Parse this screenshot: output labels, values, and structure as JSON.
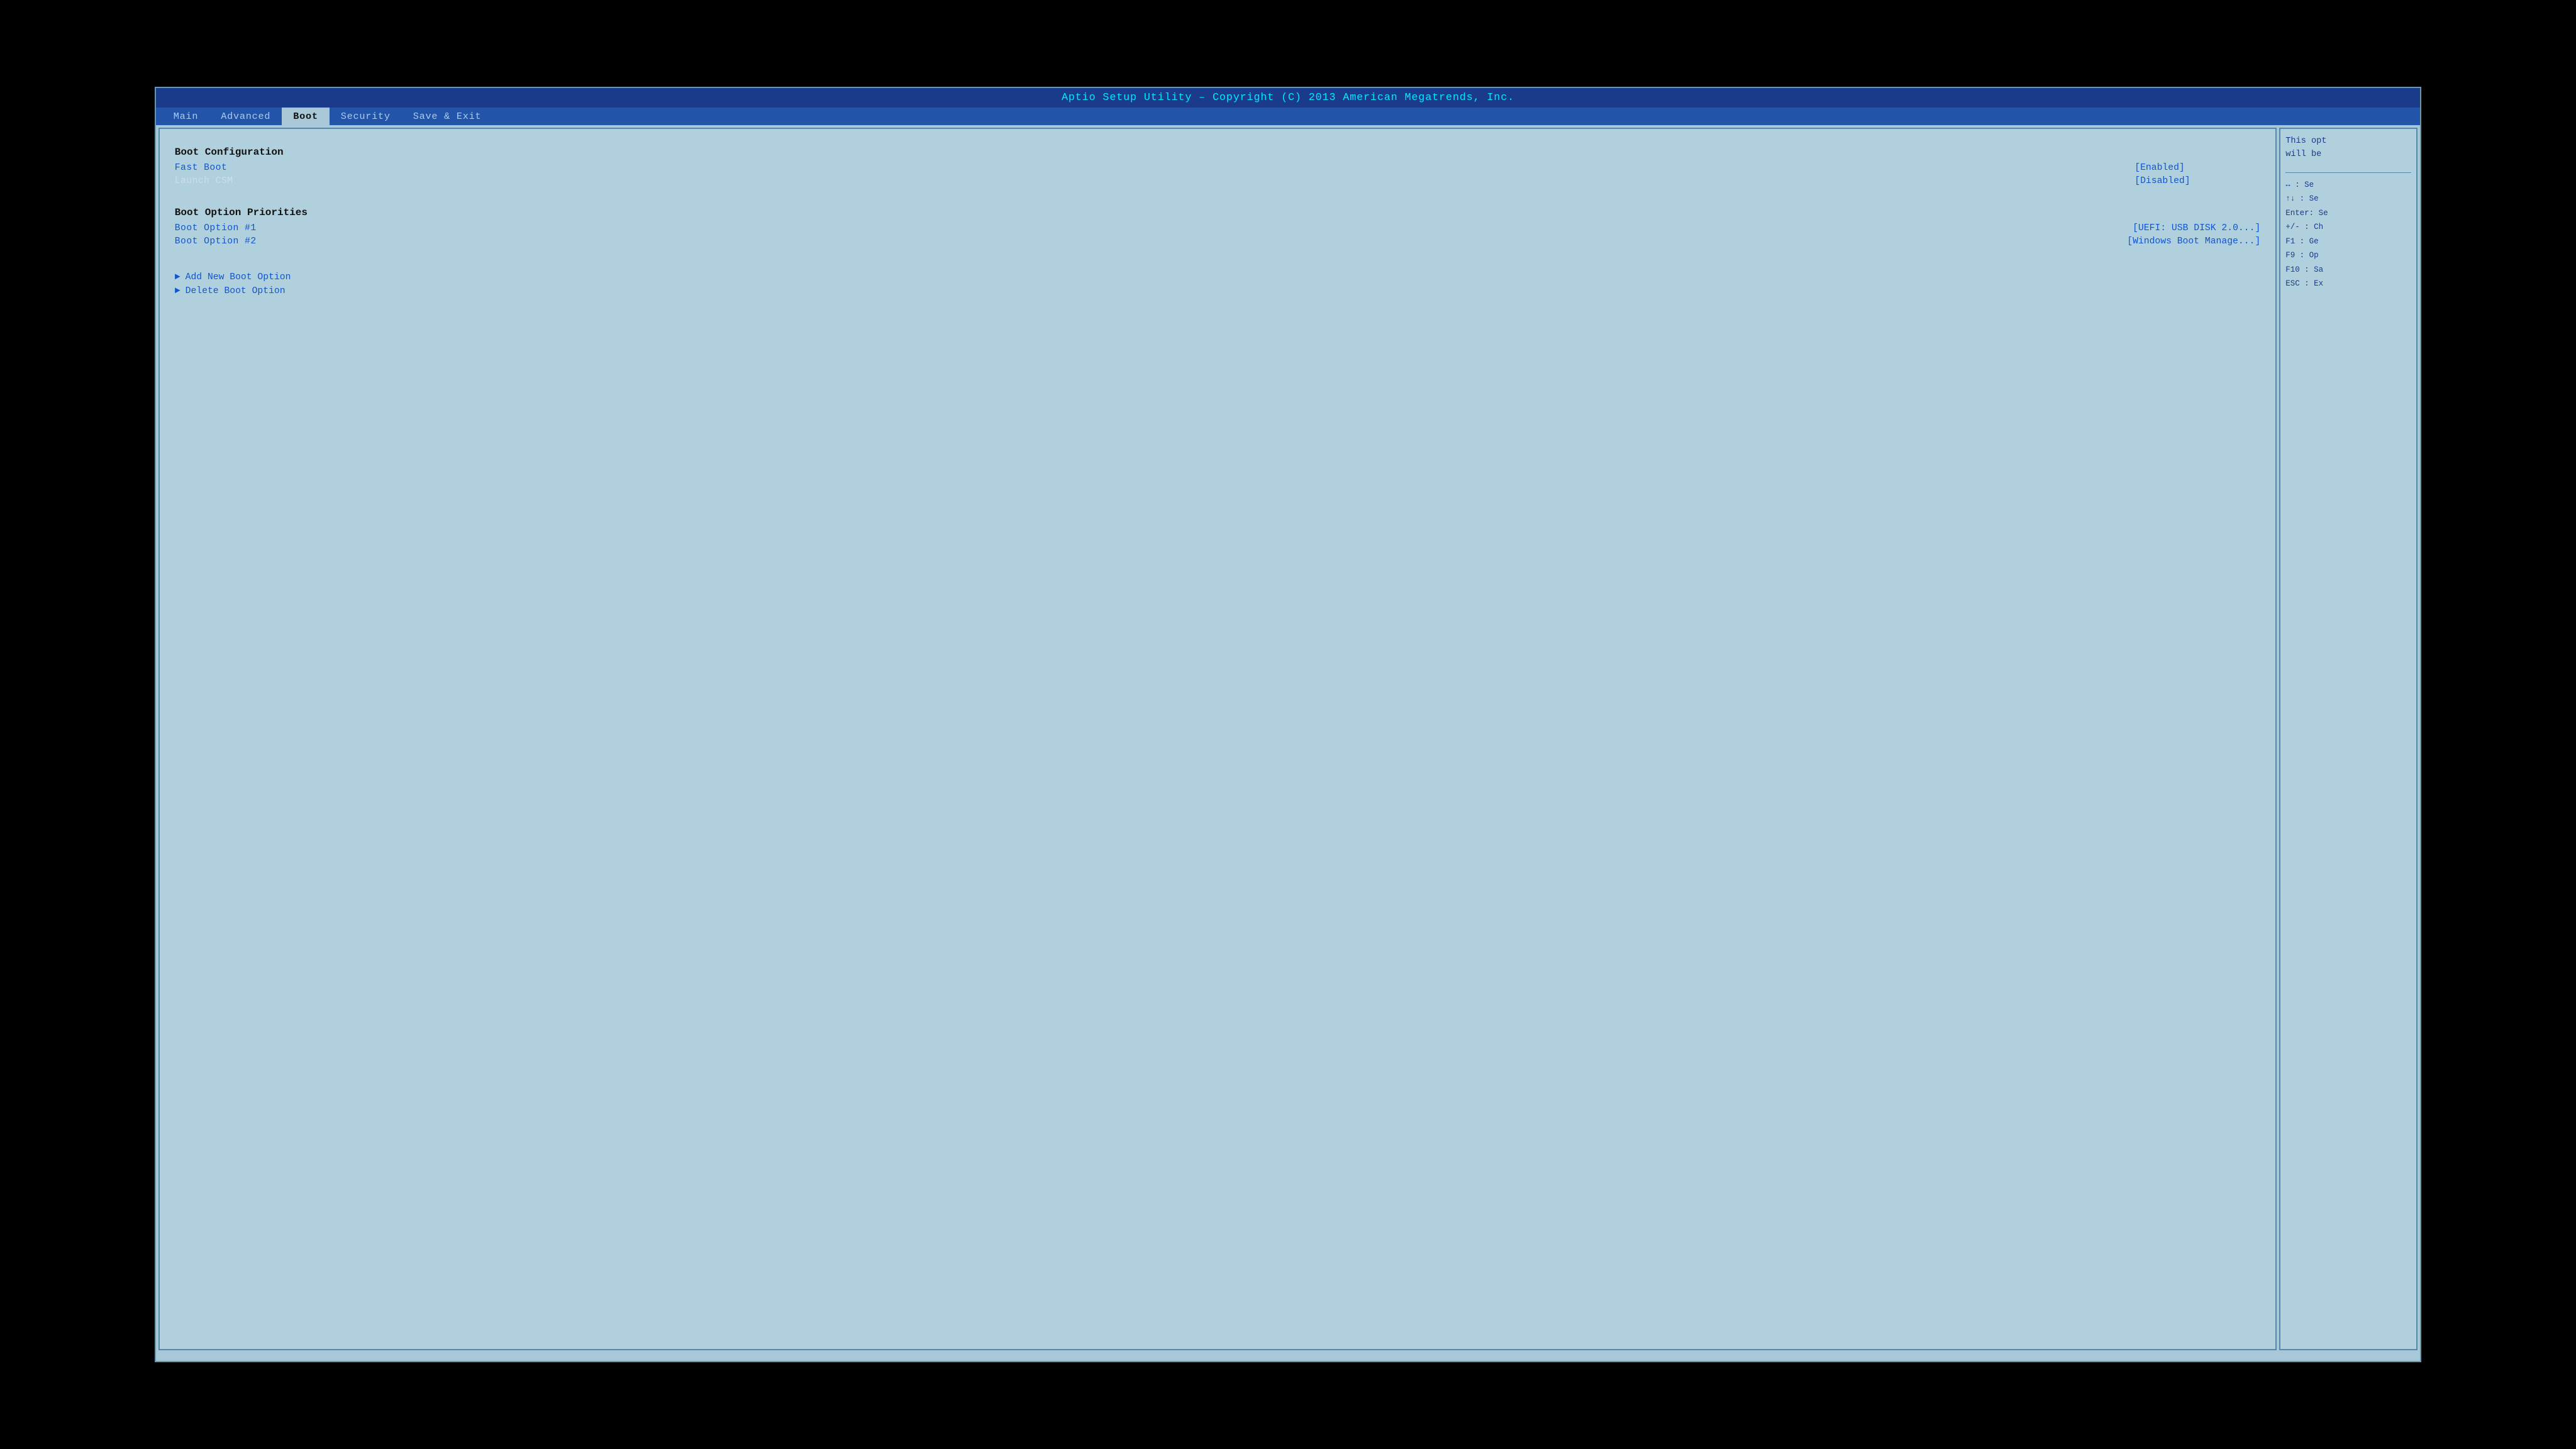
{
  "title_bar": {
    "text": "Aptio Setup Utility – Copyright (C) 2013 American Megatrends, Inc."
  },
  "nav": {
    "tabs": [
      {
        "label": "Main",
        "active": false
      },
      {
        "label": "Advanced",
        "active": false
      },
      {
        "label": "Boot",
        "active": true
      },
      {
        "label": "Security",
        "active": false
      },
      {
        "label": "Save & Exit",
        "active": false
      }
    ]
  },
  "main": {
    "boot_config_header": "Boot Configuration",
    "fast_boot_label": "Fast Boot",
    "fast_boot_value": "[Enabled]",
    "launch_csm_label": "Launch CSM",
    "launch_csm_value": "[Disabled]",
    "boot_priorities_header": "Boot Option Priorities",
    "boot_option1_label": "Boot Option #1",
    "boot_option1_value": "[UEFI:  USB DISK 2.0...]",
    "boot_option2_label": "Boot Option #2",
    "boot_option2_value": "[Windows Boot Manage...]",
    "add_new_boot": "Add New Boot Option",
    "delete_boot": "Delete Boot Option"
  },
  "sidebar": {
    "help_line1": "This opt",
    "help_line2": "will be",
    "key_arrows": "↔  : Se",
    "key_updown": "↑↓  : Se",
    "key_enter": "Enter: Se",
    "key_plusminus": "+/-  : Ch",
    "key_f1": "F1   : Ge",
    "key_f9": "F9   : Op",
    "key_f10": "F10  : Sa",
    "key_esc": "ESC  : Ex"
  }
}
